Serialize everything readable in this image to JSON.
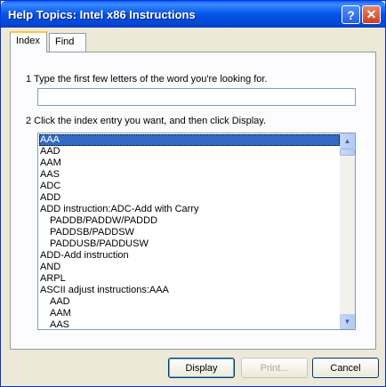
{
  "window": {
    "title": "Help Topics: Intel x86 Instructions",
    "help_button": "?",
    "close_button": "✕"
  },
  "tabs": [
    {
      "label": "Index",
      "active": true
    },
    {
      "label": "Find",
      "active": false
    }
  ],
  "step1": {
    "label": "1  Type the first few letters of the word you're looking for."
  },
  "search": {
    "value": "",
    "placeholder": ""
  },
  "step2": {
    "label": "2  Click the index entry you want, and then click Display."
  },
  "index_items": [
    {
      "label": "AAA",
      "indent": 0,
      "selected": true
    },
    {
      "label": "AAD",
      "indent": 0
    },
    {
      "label": "AAM",
      "indent": 0
    },
    {
      "label": "AAS",
      "indent": 0
    },
    {
      "label": "ADC",
      "indent": 0
    },
    {
      "label": "ADD",
      "indent": 0
    },
    {
      "label": "ADD instruction:ADC-Add with Carry",
      "indent": 0
    },
    {
      "label": "PADDB/PADDW/PADDD",
      "indent": 1
    },
    {
      "label": "PADDSB/PADDSW",
      "indent": 1
    },
    {
      "label": "PADDUSB/PADDUSW",
      "indent": 1
    },
    {
      "label": "ADD-Add instruction",
      "indent": 0
    },
    {
      "label": "AND",
      "indent": 0
    },
    {
      "label": "ARPL",
      "indent": 0
    },
    {
      "label": "ASCII adjust instructions:AAA",
      "indent": 0
    },
    {
      "label": "AAD",
      "indent": 1
    },
    {
      "label": "AAM",
      "indent": 1
    },
    {
      "label": "AAS",
      "indent": 1
    }
  ],
  "scrollbar": {
    "up_icon": "▲",
    "down_icon": "▼"
  },
  "buttons": {
    "display": "Display",
    "print": "Print...",
    "cancel": "Cancel"
  }
}
